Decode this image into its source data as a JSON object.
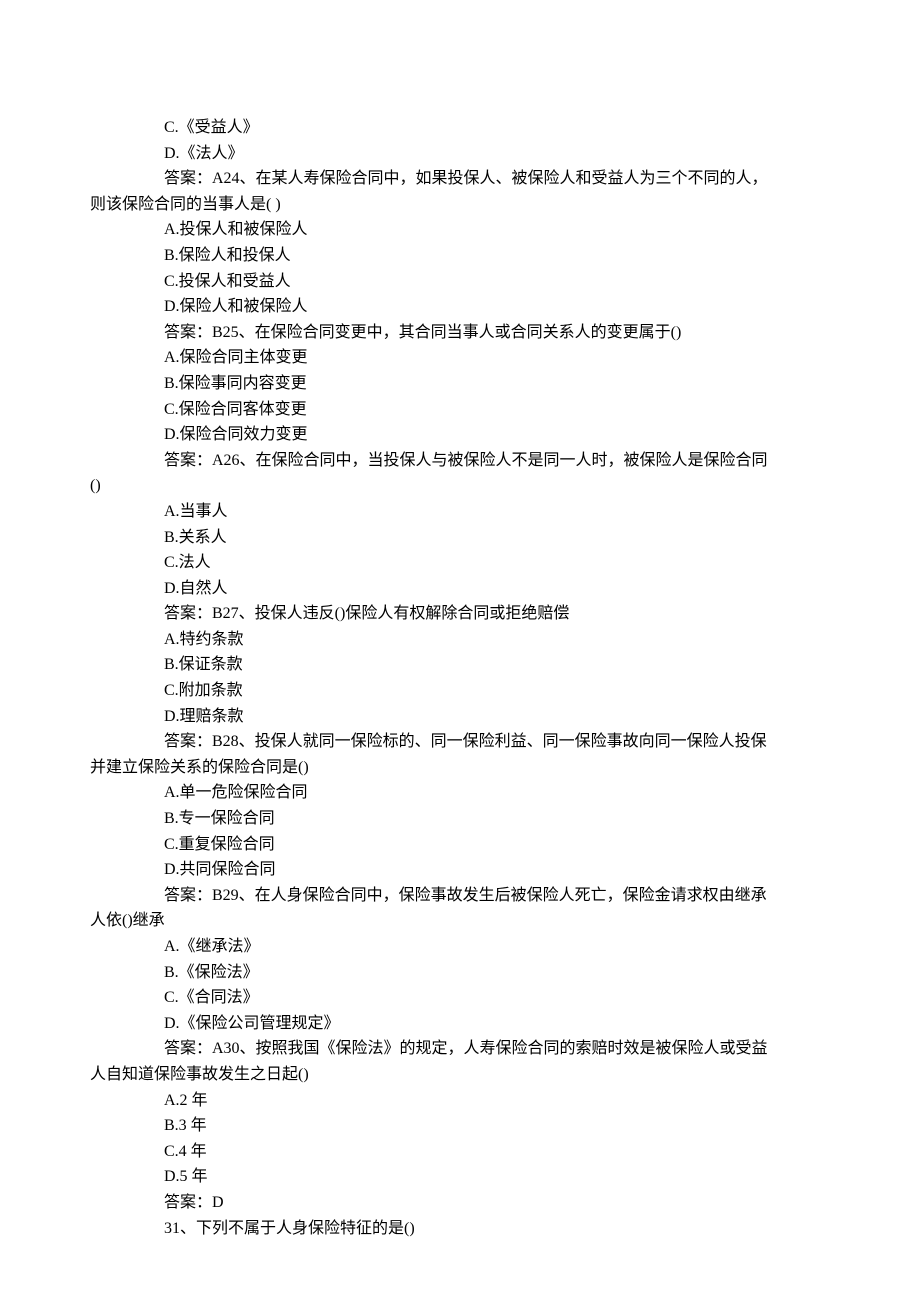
{
  "lines": [
    {
      "indent": true,
      "text": "C.《受益人》"
    },
    {
      "indent": true,
      "text": "D.《法人》"
    },
    {
      "indent": true,
      "text": "答案：A24、在某人寿保险合同中，如果投保人、被保险人和受益人为三个不同的人，"
    },
    {
      "indent": false,
      "text": "则该保险合同的当事人是( )"
    },
    {
      "indent": true,
      "text": "A.投保人和被保险人"
    },
    {
      "indent": true,
      "text": "B.保险人和投保人"
    },
    {
      "indent": true,
      "text": "C.投保人和受益人"
    },
    {
      "indent": true,
      "text": "D.保险人和被保险人"
    },
    {
      "indent": true,
      "text": "答案：B25、在保险合同变更中，其合同当事人或合同关系人的变更属于()"
    },
    {
      "indent": true,
      "text": "A.保险合同主体变更"
    },
    {
      "indent": true,
      "text": "B.保险事同内容变更"
    },
    {
      "indent": true,
      "text": "C.保险合同客体变更"
    },
    {
      "indent": true,
      "text": "D.保险合同效力变更"
    },
    {
      "indent": true,
      "text": "答案：A26、在保险合同中，当投保人与被保险人不是同一人时，被保险人是保险合同"
    },
    {
      "indent": false,
      "text": "()"
    },
    {
      "indent": true,
      "text": "A.当事人"
    },
    {
      "indent": true,
      "text": "B.关系人"
    },
    {
      "indent": true,
      "text": "C.法人"
    },
    {
      "indent": true,
      "text": "D.自然人"
    },
    {
      "indent": true,
      "text": "答案：B27、投保人违反()保险人有权解除合同或拒绝赔偿"
    },
    {
      "indent": true,
      "text": "A.特约条款"
    },
    {
      "indent": true,
      "text": "B.保证条款"
    },
    {
      "indent": true,
      "text": "C.附加条款"
    },
    {
      "indent": true,
      "text": "D.理赔条款"
    },
    {
      "indent": true,
      "text": "答案：B28、投保人就同一保险标的、同一保险利益、同一保险事故向同一保险人投保"
    },
    {
      "indent": false,
      "text": "并建立保险关系的保险合同是()"
    },
    {
      "indent": true,
      "text": "A.单一危险保险合同"
    },
    {
      "indent": true,
      "text": "B.专一保险合同"
    },
    {
      "indent": true,
      "text": "C.重复保险合同"
    },
    {
      "indent": true,
      "text": "D.共同保险合同"
    },
    {
      "indent": true,
      "text": "答案：B29、在人身保险合同中，保险事故发生后被保险人死亡，保险金请求权由继承"
    },
    {
      "indent": false,
      "text": "人依()继承"
    },
    {
      "indent": true,
      "text": "A.《继承法》"
    },
    {
      "indent": true,
      "text": "B.《保险法》"
    },
    {
      "indent": true,
      "text": "C.《合同法》"
    },
    {
      "indent": true,
      "text": "D.《保险公司管理规定》"
    },
    {
      "indent": true,
      "text": "答案：A30、按照我国《保险法》的规定，人寿保险合同的索赔时效是被保险人或受益"
    },
    {
      "indent": false,
      "text": "人自知道保险事故发生之日起()"
    },
    {
      "indent": true,
      "text": "A.2 年"
    },
    {
      "indent": true,
      "text": "B.3 年"
    },
    {
      "indent": true,
      "text": "C.4 年"
    },
    {
      "indent": true,
      "text": "D.5 年"
    },
    {
      "indent": true,
      "text": "答案：D"
    },
    {
      "indent": true,
      "text": "31、下列不属于人身保险特征的是()"
    }
  ]
}
